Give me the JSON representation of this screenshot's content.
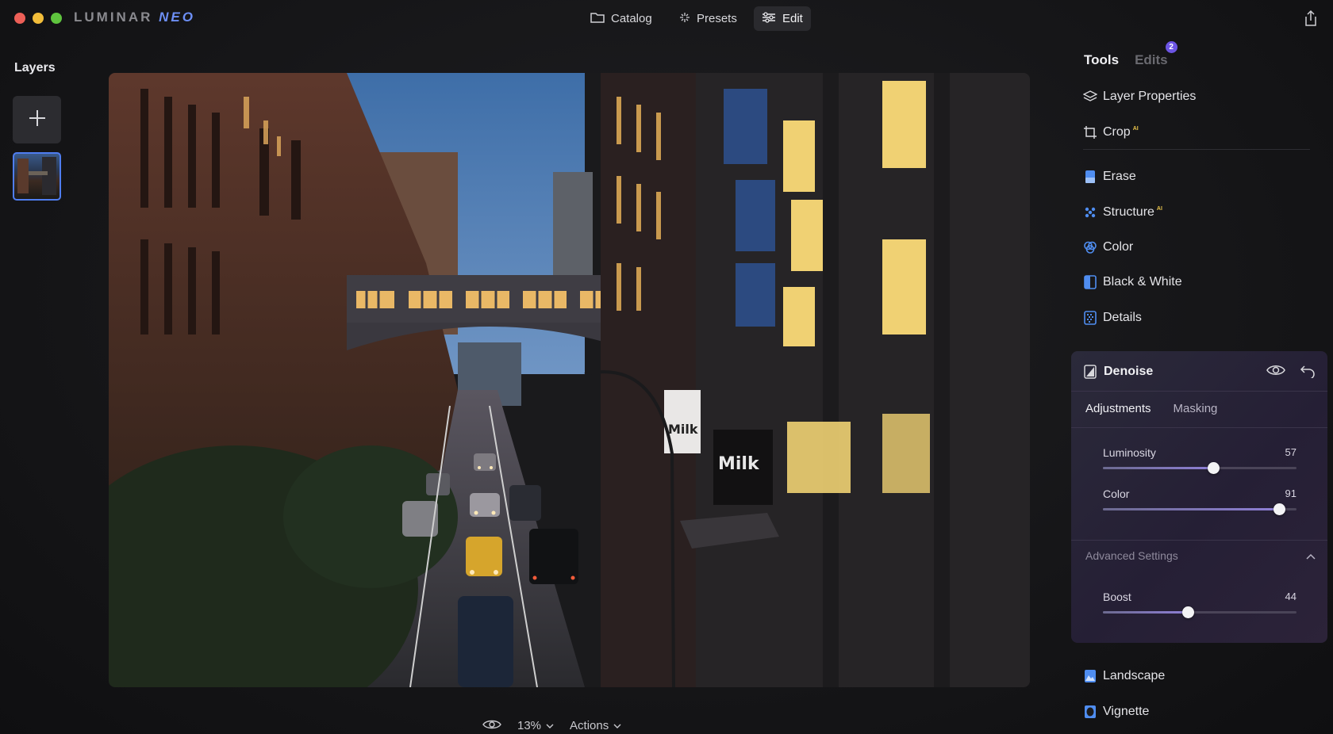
{
  "app": {
    "brand_part1": "LUMINAR",
    "brand_part2": "NEO"
  },
  "topnav": {
    "catalog": "Catalog",
    "presets": "Presets",
    "edit": "Edit"
  },
  "layers": {
    "title": "Layers"
  },
  "bottombar": {
    "zoom": "13%",
    "actions": "Actions"
  },
  "panel": {
    "tab_tools": "Tools",
    "tab_edits": "Edits",
    "edits_badge": "2",
    "tools_top": [
      {
        "label": "Layer Properties",
        "ai": ""
      },
      {
        "label": "Crop",
        "ai": "AI"
      }
    ],
    "tools_mid": [
      {
        "label": "Erase",
        "ai": ""
      },
      {
        "label": "Structure",
        "ai": "AI"
      },
      {
        "label": "Color",
        "ai": ""
      },
      {
        "label": "Black & White",
        "ai": ""
      },
      {
        "label": "Details",
        "ai": ""
      }
    ],
    "denoise": {
      "title": "Denoise",
      "tab_adjustments": "Adjustments",
      "tab_masking": "Masking",
      "luminosity": {
        "label": "Luminosity",
        "value": 57,
        "value_text": "57"
      },
      "color": {
        "label": "Color",
        "value": 91,
        "value_text": "91"
      },
      "advanced": "Advanced Settings",
      "boost": {
        "label": "Boost",
        "value": 44,
        "value_text": "44"
      }
    },
    "tools_bottom": [
      {
        "label": "Landscape",
        "ai": ""
      },
      {
        "label": "Vignette",
        "ai": ""
      }
    ]
  },
  "photo": {
    "sign_text_1": "Milk",
    "sign_text_2": "Milk"
  },
  "colors": {
    "accent": "#4f7df0",
    "ai_badge": "#e7c24a",
    "edits_badge": "#6c55e4"
  }
}
